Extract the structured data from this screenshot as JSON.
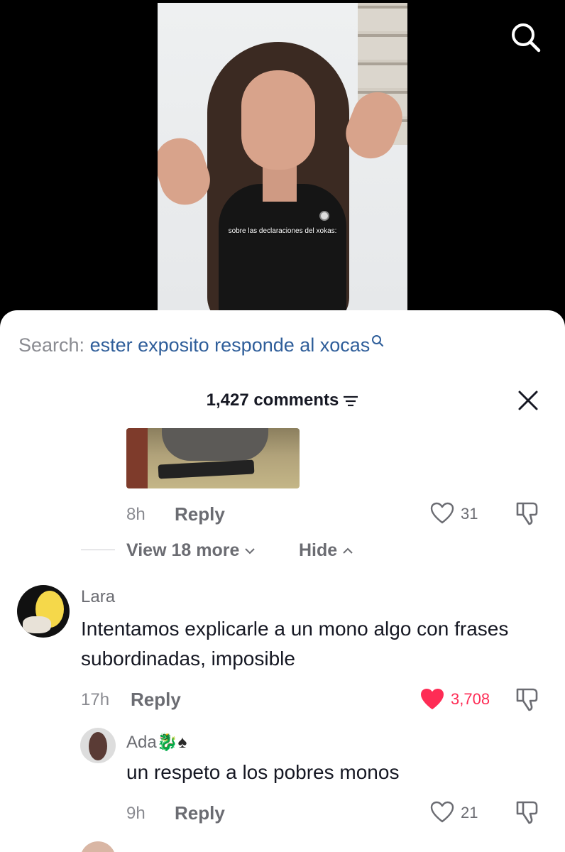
{
  "video": {
    "caption": "sobre las declaraciones del xokas:"
  },
  "search": {
    "prefix": "Search:",
    "term": "ester exposito responde al xocas"
  },
  "comments_header": {
    "count_label": "1,427 comments"
  },
  "reply_block": {
    "time": "8h",
    "reply_label": "Reply",
    "likes": "31",
    "view_more_label": "View 18 more",
    "hide_label": "Hide"
  },
  "comments": [
    {
      "username": "Lara",
      "text": "Intentamos explicarle a un mono algo con frases subordinadas, imposible",
      "time": "17h",
      "reply_label": "Reply",
      "likes": "3,708",
      "liked": true
    },
    {
      "username": "Ada",
      "username_emoji": "🐉♠",
      "text": "un respeto a los pobres monos",
      "time": "9h",
      "reply_label": "Reply",
      "likes": "21",
      "liked": false
    }
  ],
  "colors": {
    "accent_like": "#fe2c55",
    "search_term": "#2f5e9a",
    "text_primary": "#161823",
    "text_secondary": "#8a8b91"
  },
  "icons": [
    "search-icon",
    "filter-icon",
    "close-icon",
    "heart-icon",
    "dislike-icon",
    "chevron-down-icon",
    "chevron-up-icon"
  ]
}
